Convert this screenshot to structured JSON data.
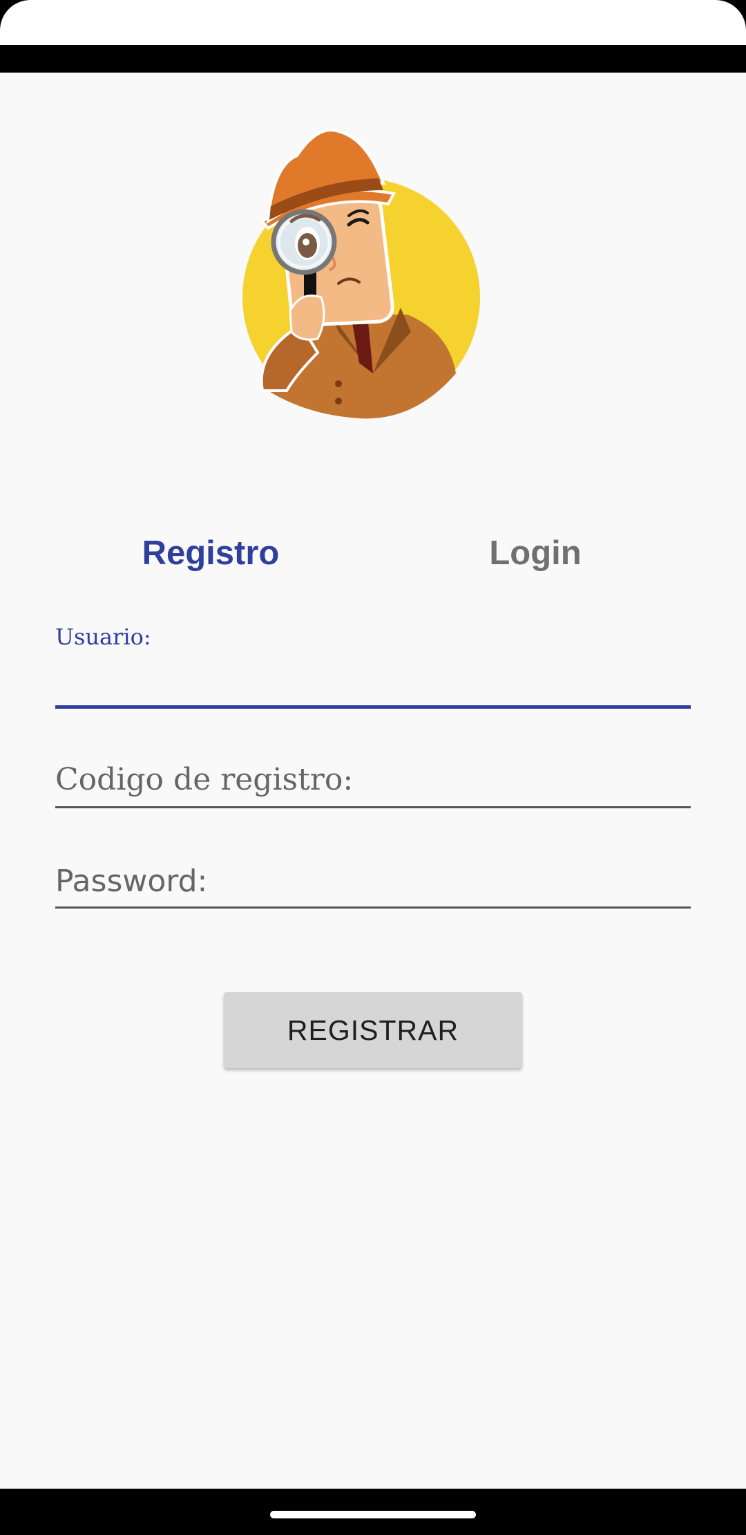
{
  "tabs": {
    "registro_label": "Registro",
    "login_label": "Login",
    "active": "Registro"
  },
  "form": {
    "usuario": {
      "label": "Usuario:",
      "value": ""
    },
    "codigo": {
      "label": "Codigo de registro:",
      "value": ""
    },
    "password": {
      "label": "Password:",
      "value": ""
    }
  },
  "actions": {
    "register_label": "REGISTRAR"
  },
  "colors": {
    "accent": "#2f3f9e",
    "inactive_tab": "#707070",
    "background": "#f9f9f9",
    "button_bg": "#d6d6d6",
    "logo_circle": "#f5d22e",
    "hat": "#e07a2a",
    "coat": "#c27530"
  },
  "icons": {
    "logo": "detective-with-magnifying-glass"
  }
}
